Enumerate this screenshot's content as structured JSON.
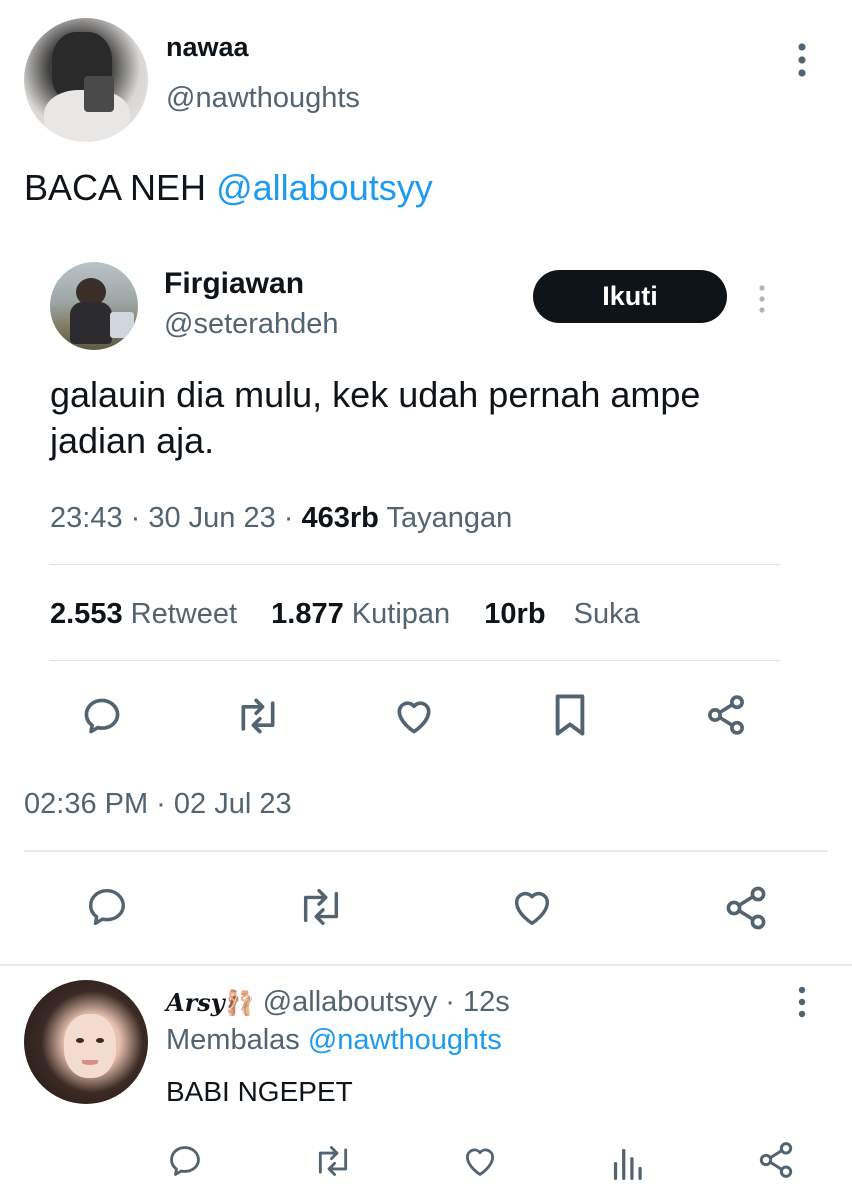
{
  "main_tweet": {
    "author_name": "nawaa",
    "author_handle": "@nawthoughts",
    "text_prefix": "BACA NEH",
    "text_mention": "@allaboutsyy",
    "timestamp": "02:36 PM · 02 Jul 23",
    "more_icon": "more-vertical-icon",
    "actions": [
      "reply-icon",
      "retweet-icon",
      "like-icon",
      "share-icon"
    ]
  },
  "quoted_tweet": {
    "author_name": "Firgiawan",
    "author_handle": "@seterahdeh",
    "follow_label": "Ikuti",
    "text": "galauin dia mulu, kek udah pernah ampe jadian aja.",
    "time": "23:43 · 30 Jun 23 · ",
    "views_count": "463rb",
    "views_label": "Tayangan",
    "stats": {
      "retweets_count": "2.553",
      "retweets_label": "Retweet",
      "quotes_count": "1.877",
      "quotes_label": "Kutipan",
      "likes_count": "10rb",
      "likes_label": "Suka"
    },
    "actions": [
      "reply-icon",
      "retweet-icon",
      "like-icon",
      "bookmark-icon",
      "share-icon"
    ]
  },
  "reply": {
    "author_name": "Arsy",
    "author_emoji": "🩰",
    "author_handle": "@allaboutsyy",
    "time": "· 12s",
    "replying_label": "Membalas",
    "replying_to": "@nawthoughts",
    "text": "BABI NGEPET",
    "actions": [
      "reply-icon",
      "retweet-icon",
      "like-icon",
      "views-icon",
      "share-icon"
    ]
  },
  "colors": {
    "text": "#0f1419",
    "muted": "#536471",
    "link": "#1d9bf0",
    "button": "#0f1419",
    "divider": "#e8ebed"
  }
}
